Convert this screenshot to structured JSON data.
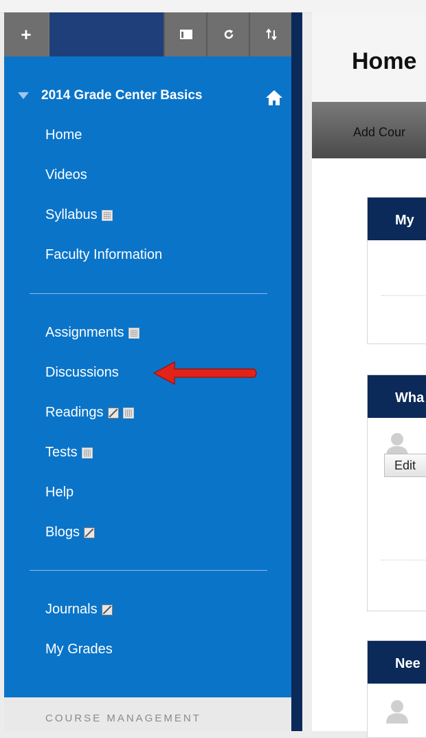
{
  "toolbar": {
    "plus_label": "+",
    "icons": [
      "add-icon",
      "window-icon",
      "refresh-icon",
      "sort-icon"
    ]
  },
  "course": {
    "title": "2014 Grade Center Basics"
  },
  "nav": {
    "group1": [
      {
        "label": "Home"
      },
      {
        "label": "Videos"
      },
      {
        "label": "Syllabus"
      },
      {
        "label": "Faculty Information"
      }
    ],
    "group2": [
      {
        "label": "Assignments"
      },
      {
        "label": "Discussions"
      },
      {
        "label": "Readings"
      },
      {
        "label": "Tests"
      },
      {
        "label": "Help"
      },
      {
        "label": "Blogs"
      }
    ],
    "group3": [
      {
        "label": "Journals"
      },
      {
        "label": "My Grades"
      }
    ]
  },
  "management": {
    "label": "COURSE MANAGEMENT"
  },
  "content": {
    "page_title": "Home",
    "action_label": "Add Cour",
    "modules": [
      {
        "title": "My"
      },
      {
        "title": "Wha"
      },
      {
        "title": "Nee"
      }
    ],
    "edit_label": "Edit"
  },
  "colors": {
    "sidebar": "#0a74c9",
    "sidebar_edge": "#0b2a59",
    "toolbar": "#747474",
    "module_header": "#0b2a59",
    "arrow": "#e2231a"
  }
}
